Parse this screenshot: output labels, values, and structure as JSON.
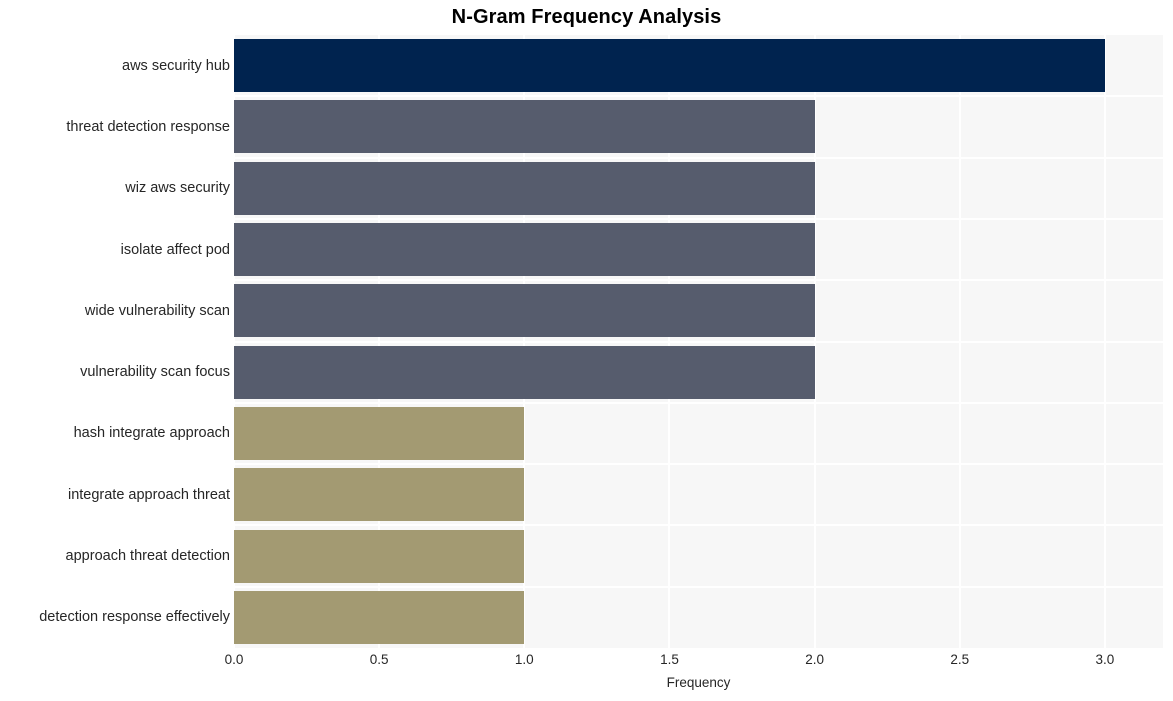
{
  "chart_data": {
    "type": "bar",
    "orientation": "horizontal",
    "title": "N-Gram Frequency Analysis",
    "xlabel": "Frequency",
    "ylabel": "",
    "xlim": [
      0,
      3.2
    ],
    "xticks": [
      "0.0",
      "0.5",
      "1.0",
      "1.5",
      "2.0",
      "2.5",
      "3.0"
    ],
    "xtick_values": [
      0.0,
      0.5,
      1.0,
      1.5,
      2.0,
      2.5,
      3.0
    ],
    "grid": true,
    "legend": "none",
    "categories": [
      "aws security hub",
      "threat detection response",
      "wiz aws security",
      "isolate affect pod",
      "wide vulnerability scan",
      "vulnerability scan focus",
      "hash integrate approach",
      "integrate approach threat",
      "approach threat detection",
      "detection response effectively"
    ],
    "values": [
      3,
      2,
      2,
      2,
      2,
      2,
      1,
      1,
      1,
      1
    ],
    "bar_colors": [
      "#00234f",
      "#565c6d",
      "#565c6d",
      "#565c6d",
      "#565c6d",
      "#565c6d",
      "#a39a72",
      "#a39a72",
      "#a39a72",
      "#a39a72"
    ],
    "plot_background": "#f7f7f7",
    "grid_color": "#ffffff",
    "figure_background": "#ffffff"
  }
}
